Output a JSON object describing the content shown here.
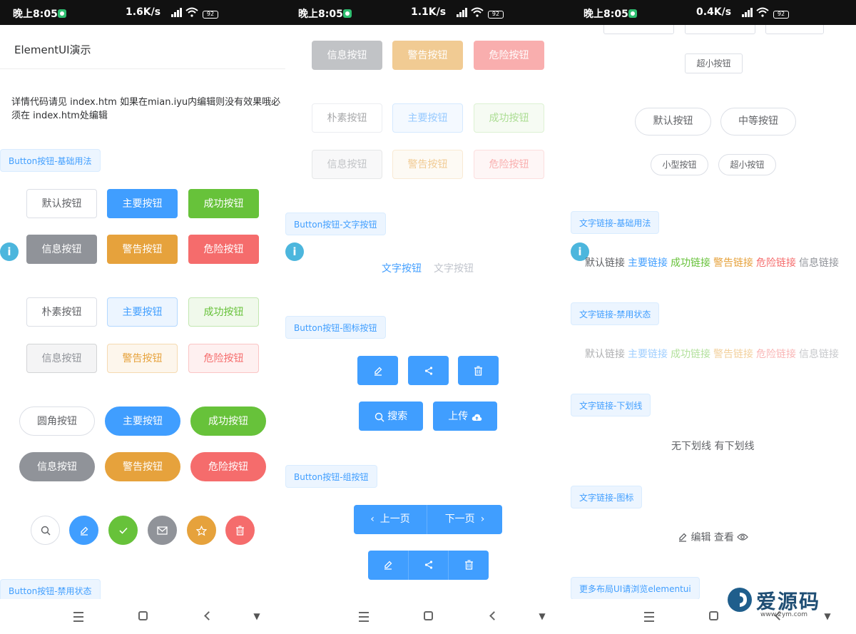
{
  "status_bars": [
    {
      "time": "晚上8:05",
      "net": "1.6K/s",
      "battery": "92"
    },
    {
      "time": "晚上8:05",
      "net": "1.1K/s",
      "battery": "92"
    },
    {
      "time": "晚上8:05",
      "net": "0.4K/s",
      "battery": "92"
    }
  ],
  "panel1": {
    "app_title": "ElementUI演示",
    "intro": "详情代码请见 index.htm 如果在mian.iyu内编辑则没有效果哦必须在 index.htm处编辑",
    "tag_basic": "Button按钮-基础用法",
    "row1": [
      "默认按钮",
      "主要按钮",
      "成功按钮"
    ],
    "row2": [
      "信息按钮",
      "警告按钮",
      "危险按钮"
    ],
    "row3": [
      "朴素按钮",
      "主要按钮",
      "成功按钮"
    ],
    "row4": [
      "信息按钮",
      "警告按钮",
      "危险按钮"
    ],
    "row5": [
      "圆角按钮",
      "主要按钮",
      "成功按钮"
    ],
    "row6": [
      "信息按钮",
      "警告按钮",
      "危险按钮"
    ],
    "circle_icons": [
      "search-icon",
      "edit-icon",
      "check-icon",
      "message-icon",
      "star-icon",
      "delete-icon"
    ],
    "tag_disabled": "Button按钮-禁用状态"
  },
  "panel2": {
    "row1": [
      "信息按钮",
      "警告按钮",
      "危险按钮"
    ],
    "row2": [
      "朴素按钮",
      "主要按钮",
      "成功按钮"
    ],
    "row3": [
      "信息按钮",
      "警告按钮",
      "危险按钮"
    ],
    "tag_text": "Button按钮-文字按钮",
    "text_btn": "文字按钮",
    "text_btn_disabled": "文字按钮",
    "tag_icon": "Button按钮-图标按钮",
    "search_label": "搜索",
    "upload_label": "上传",
    "tag_group": "Button按钮-组按钮",
    "prev_label": "上一页",
    "next_label": "下一页"
  },
  "panel3": {
    "top_btns": [
      "",
      "",
      ""
    ],
    "mini_top": "超小按钮",
    "round_row1": [
      "默认按钮",
      "中等按钮"
    ],
    "round_row2": [
      "小型按钮",
      "超小按钮"
    ],
    "tag_link_basic": "文字链接-基础用法",
    "links": [
      "默认链接",
      "主要链接",
      "成功链接",
      "警告链接",
      "危险链接",
      "信息链接"
    ],
    "tag_link_disabled": "文字链接-禁用状态",
    "links_disabled": [
      "默认链接",
      "主要链接",
      "成功链接",
      "警告链接",
      "危险链接",
      "信息链接"
    ],
    "tag_link_underline": "文字链接-下划线",
    "underline_text": "无下划线 有下划线",
    "tag_link_icon": "文字链接-图标",
    "edit_link": "编辑",
    "view_link": "查看",
    "tag_more": "更多布局UI请浏览elementui"
  },
  "watermark": {
    "brand": "爱源码",
    "url": "www.2ym.com"
  },
  "colors": {
    "primary": "#409eff",
    "success": "#67c23a",
    "info": "#909399",
    "warning": "#e6a23c",
    "danger": "#f56c6c"
  }
}
